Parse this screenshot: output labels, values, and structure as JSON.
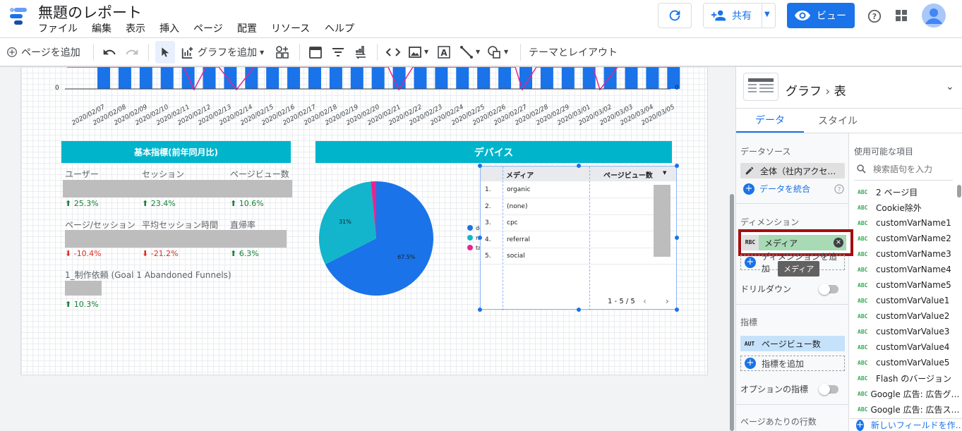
{
  "app": {
    "title": "無題のレポート"
  },
  "menu": [
    "ファイル",
    "編集",
    "表示",
    "挿入",
    "ページ",
    "配置",
    "リソース",
    "ヘルプ"
  ],
  "header": {
    "share_label": "共有",
    "view_label": "ビュー"
  },
  "toolbar": {
    "add_page": "ページを追加",
    "add_chart": "グラフを追加",
    "theme_layout": "テーマとレイアウト"
  },
  "timeseries": {
    "dates": [
      "2020/02/07",
      "2020/02/08",
      "2020/02/09",
      "2020/02/10",
      "2020/02/11",
      "2020/02/12",
      "2020/02/13",
      "2020/02/14",
      "2020/02/15",
      "2020/02/16",
      "2020/02/17",
      "2020/02/18",
      "2020/02/19",
      "2020/02/20",
      "2020/02/21",
      "2020/02/22",
      "2020/02/23",
      "2020/02/24",
      "2020/02/25",
      "2020/02/26",
      "2020/02/27",
      "2020/02/28",
      "2020/02/29",
      "2020/03/01",
      "2020/03/02",
      "2020/03/03",
      "2020/03/04",
      "2020/03/05"
    ],
    "y_left_zero": "0",
    "y_right_zero": "0"
  },
  "scorecards": {
    "title": "基本指標(前年同月比)",
    "row1": [
      {
        "label": "ユーザー",
        "delta": "25.3%",
        "dir": "up"
      },
      {
        "label": "セッション",
        "delta": "23.4%",
        "dir": "up"
      },
      {
        "label": "ページビュー数",
        "delta": "10.6%",
        "dir": "up"
      }
    ],
    "row2": [
      {
        "label": "ページ/セッション",
        "delta": "-10.4%",
        "dir": "down"
      },
      {
        "label": "平均セッション時間",
        "delta": "-21.2%",
        "dir": "down"
      },
      {
        "label": "直帰率",
        "delta": "6.3%",
        "dir": "up"
      }
    ],
    "row3": {
      "label": "1_制作依頼 (Goal 1 Abandoned Funnels)",
      "delta": "10.3%",
      "dir": "up"
    }
  },
  "devices": {
    "title": "デバイス",
    "chart_data": {
      "type": "pie",
      "labels": [
        "desktop",
        "mobile",
        "tablet"
      ],
      "values": [
        67.5,
        31,
        1.5
      ],
      "value_labels": [
        "67.5%",
        "31%",
        ""
      ],
      "colors": [
        "#1a73e8",
        "#12b5cb",
        "#e52592"
      ]
    }
  },
  "media_table": {
    "col_media": "メディア",
    "col_pv": "ページビュー数",
    "rows": [
      {
        "n": "1.",
        "media": "organic"
      },
      {
        "n": "2.",
        "media": "(none)"
      },
      {
        "n": "3.",
        "media": "cpc"
      },
      {
        "n": "4.",
        "media": "referral"
      },
      {
        "n": "5.",
        "media": "social"
      }
    ],
    "pagination": "1 - 5 / 5"
  },
  "panel": {
    "breadcrumb_graph": "グラフ",
    "breadcrumb_type": "表",
    "tab_data": "データ",
    "tab_style": "スタイル",
    "datasource_label": "データソース",
    "datasource_value": "全体（社内アクセ…",
    "blend_label": "データを統合",
    "dimension_label": "ディメンション",
    "dimension_value": "メディア",
    "add_dimension": "ディメンションを追加",
    "tooltip": "メディア",
    "drilldown": "ドリルダウン",
    "metric_label": "指標",
    "metric_type": "AUT",
    "metric_value": "ページビュー数",
    "add_metric": "指標を追加",
    "optional_metric": "オプションの指標",
    "rows_per_page": "ページあたりの行数",
    "available_fields": "使用可能な項目",
    "search_placeholder": "検索語句を入力",
    "fields": [
      "2 ページ目",
      "Cookie除外",
      "customVarName1",
      "customVarName2",
      "customVarName3",
      "customVarName4",
      "customVarName5",
      "customVarValue1",
      "customVarValue2",
      "customVarValue3",
      "customVarValue4",
      "customVarValue5",
      "Flash のバージョン",
      "Google 広告: 広告グ…",
      "Google 広告: 広告ス…"
    ],
    "new_field": "新しいフィールドを作…"
  }
}
